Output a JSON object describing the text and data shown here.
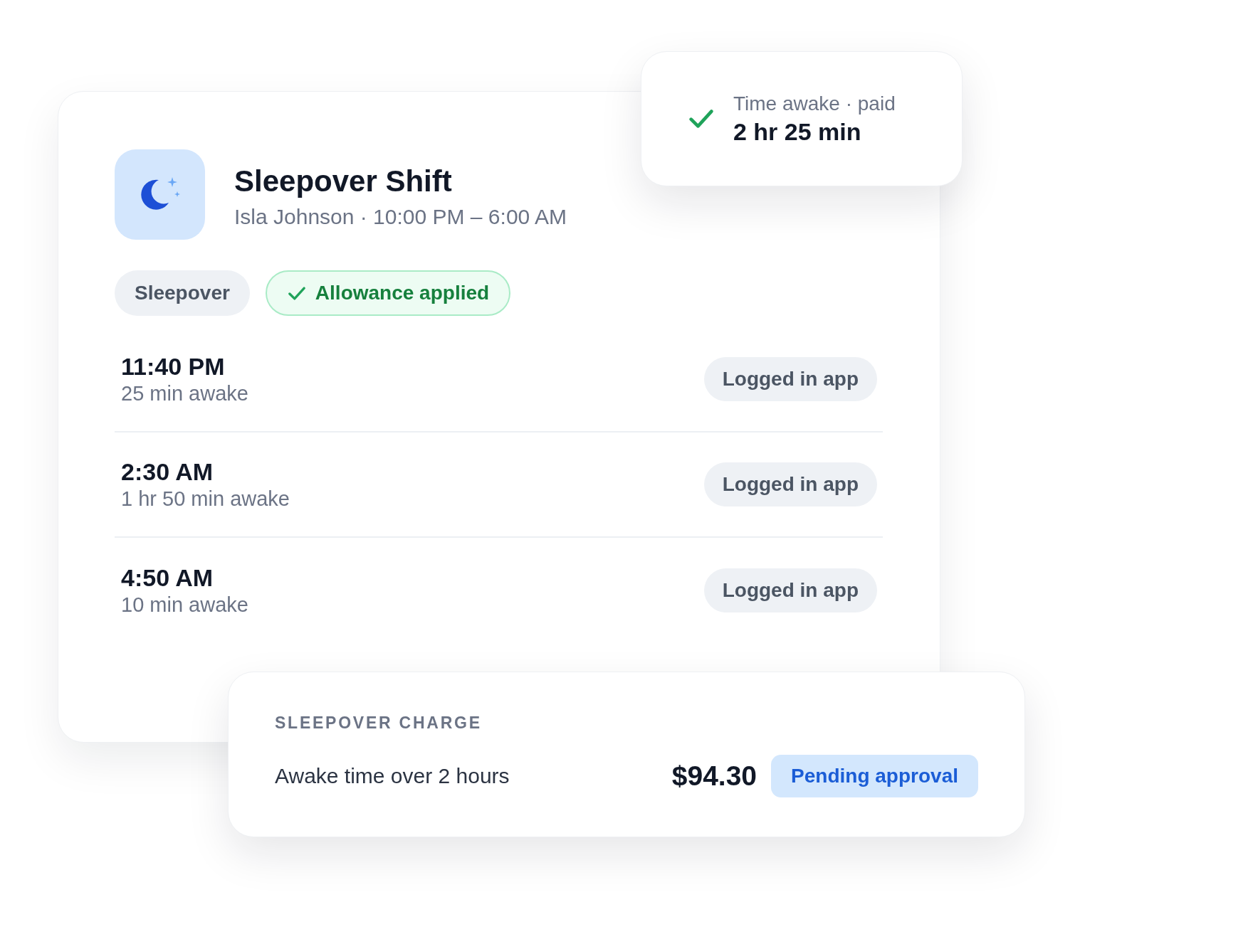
{
  "shift": {
    "title": "Sleepover Shift",
    "subtitle": "Isla Johnson · 10:00 PM – 6:00 AM",
    "tags": [
      {
        "kind": "plain",
        "label": "Sleepover"
      },
      {
        "kind": "success",
        "label": "Allowance applied"
      }
    ],
    "wakeups": [
      {
        "time": "11:40 PM",
        "duration": "25 min awake",
        "source": "Logged in app"
      },
      {
        "time": "2:30 AM",
        "duration": "1 hr 50 min awake",
        "source": "Logged in app"
      },
      {
        "time": "4:50 AM",
        "duration": "10 min awake",
        "source": "Logged in app"
      }
    ]
  },
  "awake_summary": {
    "label": "Time awake · paid",
    "value": "2 hr 25 min"
  },
  "charge": {
    "heading": "SLEEPOVER CHARGE",
    "description": "Awake time over 2 hours",
    "amount": "$94.30",
    "status": "Pending approval"
  }
}
